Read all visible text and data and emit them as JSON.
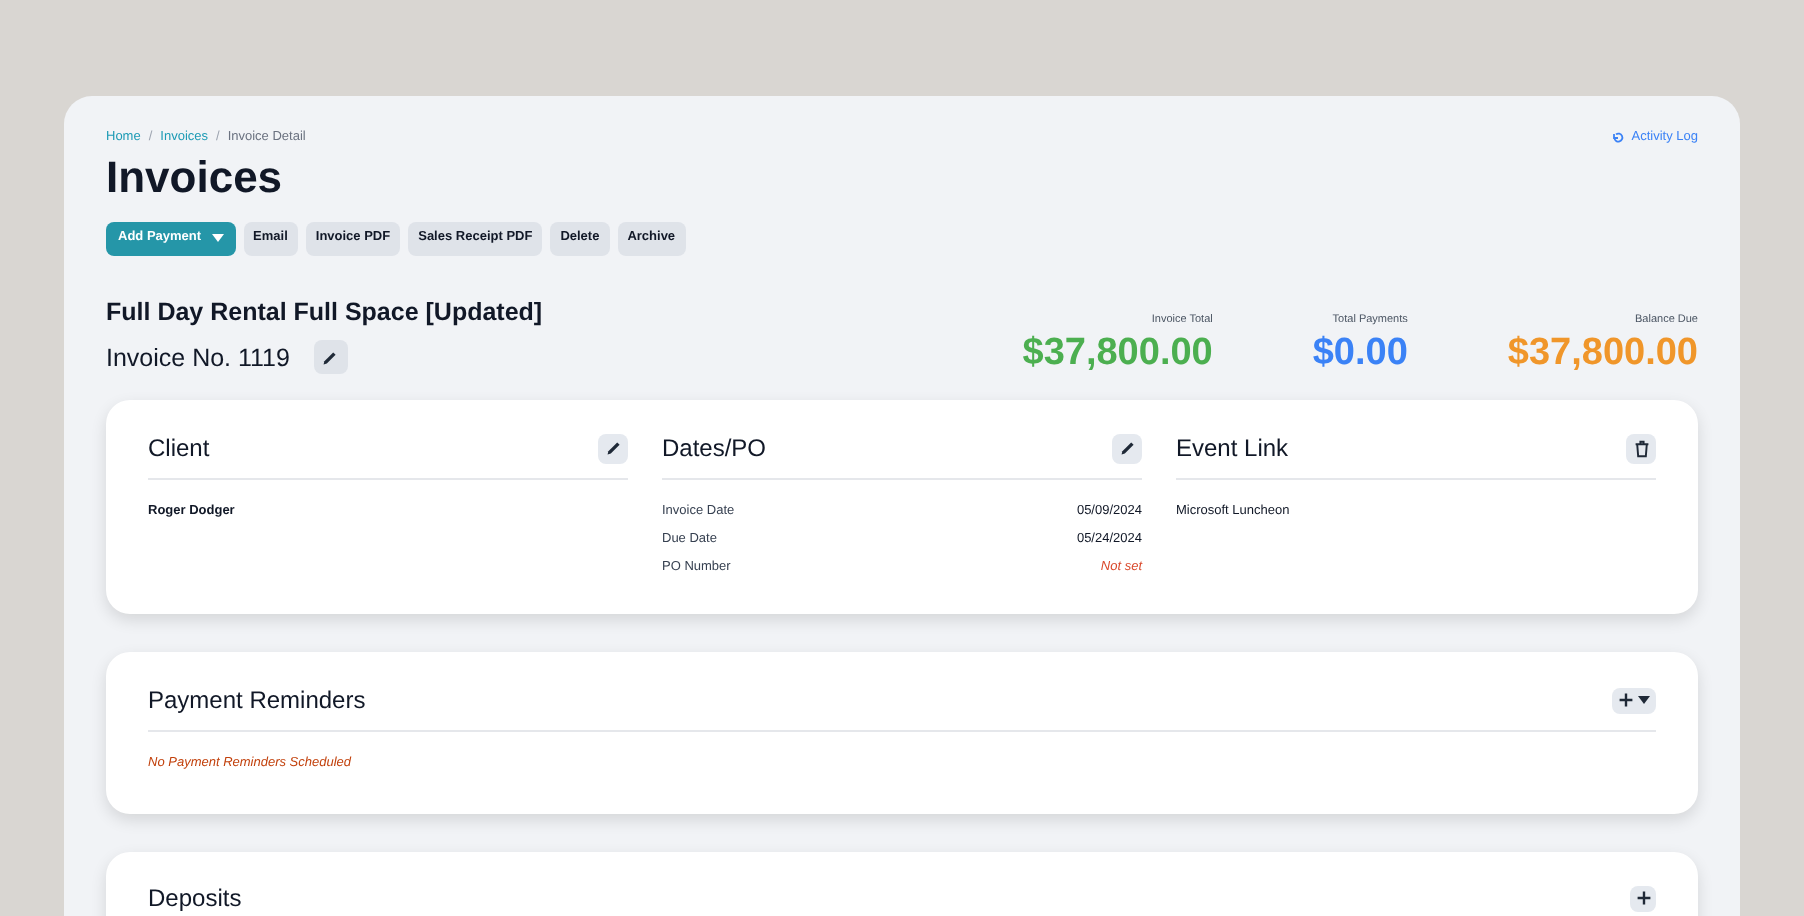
{
  "breadcrumb_separator": "/",
  "breadcrumb": [
    {
      "label": "Home",
      "link": true
    },
    {
      "label": "Invoices",
      "link": true
    },
    {
      "label": "Invoice Detail",
      "link": false
    }
  ],
  "activity_link": "Activity Log",
  "page_title": "Invoices",
  "actions": [
    {
      "label": "Add Payment",
      "kind": "primary"
    },
    {
      "label": "Email",
      "kind": "secondary"
    },
    {
      "label": "Invoice PDF",
      "kind": "secondary"
    },
    {
      "label": "Sales Receipt PDF",
      "kind": "secondary"
    },
    {
      "label": "Delete",
      "kind": "secondary"
    },
    {
      "label": "Archive",
      "kind": "secondary"
    }
  ],
  "invoice": {
    "name": "Full Day Rental Full Space [Updated]",
    "number": "Invoice No. 1119"
  },
  "totals": [
    {
      "label": "Invoice Total",
      "value": "$37,800.00",
      "color": "#4caf50"
    },
    {
      "label": "Total Payments",
      "value": "$0.00",
      "color": "#3b82f6"
    },
    {
      "label": "Balance Due",
      "value": "$37,800.00",
      "color": "#f0962a"
    }
  ],
  "summary_sections": [
    {
      "title": "Client",
      "kind": "edit",
      "lines": [
        {
          "label": "Roger Dodger",
          "kind": "name"
        }
      ]
    },
    {
      "title": "Dates/PO",
      "kind": "edit",
      "lines": [
        {
          "label": "Invoice Date",
          "value": "05/09/2024",
          "kind": "field"
        },
        {
          "label": "Due Date",
          "value": "05/24/2024",
          "kind": "field"
        },
        {
          "label": "PO Number",
          "value": "Not set",
          "kind": "missing"
        }
      ]
    },
    {
      "title": "Event Link",
      "kind": "delete",
      "lines": [
        {
          "label": "Microsoft Luncheon",
          "kind": "text"
        }
      ]
    }
  ],
  "payment_reminders": {
    "title": "Payment Reminders",
    "empty_message": "No Payment Reminders Scheduled"
  },
  "deposits": {
    "title": "Deposits"
  }
}
